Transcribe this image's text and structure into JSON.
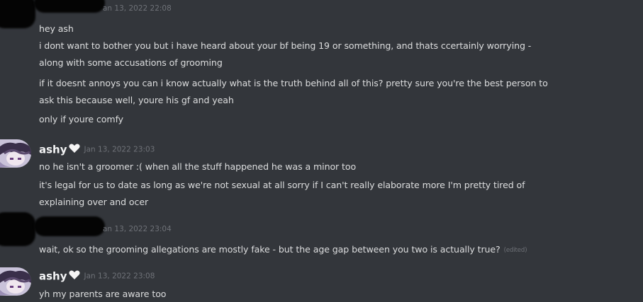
{
  "messages": [
    {
      "author": "",
      "timestamp": "an 13, 2022 22:08",
      "lines": [
        "hey ash",
        "i dont want to bother you but i have heard about your bf being 19 or something, and thats ccertainly worrying -",
        "along with some accusations of grooming",
        "if it doesnt annoys you can i know actually what is the truth behind all of this? pretty sure you're the best person to",
        "ask this because well, youre his gf and yeah",
        "only if youre comfy"
      ]
    },
    {
      "author": "ashy",
      "timestamp": "Jan 13, 2022 23:03",
      "lines": [
        "no he isn't a groomer :( when all the stuff happened he was a minor too",
        "it's legal for us to date as long as we're not sexual at all sorry if I can't really elaborate more I'm pretty tired of",
        "explaining over and ocer"
      ]
    },
    {
      "author": "",
      "timestamp": "an 13, 2022 23:04",
      "lines": [
        "wait, ok so the grooming allegations are mostly fake - but the age gap between you two is actually true?"
      ],
      "edited_label": "(edited)"
    },
    {
      "author": "ashy",
      "timestamp": "Jan 13, 2022 23:08",
      "lines": [
        "yh my parents are aware too"
      ]
    }
  ],
  "colors": {
    "background": "#33363b",
    "text": "#dcddde",
    "author": "#f3f4f5",
    "timestamp": "#6f7278",
    "redaction": "#040404",
    "heart": "#f5f5f5",
    "avatar_bg": "#c9c2d9"
  },
  "icons": {
    "author_badge": "white-heart-icon",
    "avatar": "anime-avatar-icon"
  }
}
